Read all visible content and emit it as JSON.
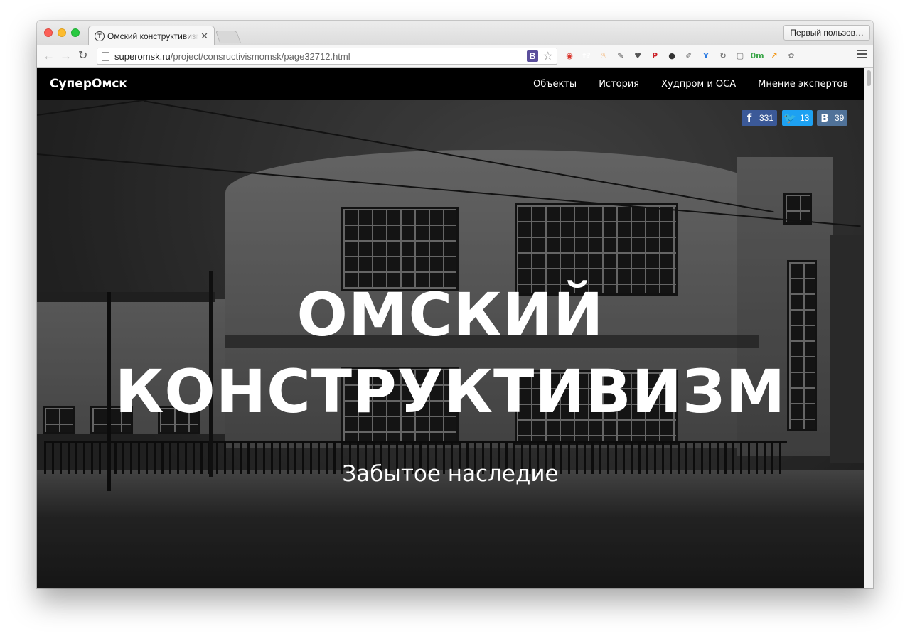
{
  "browser": {
    "tab_title": "Омский конструктивизм.",
    "tab_favicon": "T",
    "profile_button": "Первый пользов…",
    "url_host": "superomsk.ru",
    "url_path": "/project/consructivismomsk/page32712.html",
    "omnibox_badge": "B",
    "extensions": [
      {
        "name": "adblock-icon",
        "glyph": "◉",
        "color": "#d9342b"
      },
      {
        "name": "font-icon",
        "glyph": "f?",
        "color": "#ffffff"
      },
      {
        "name": "fire-icon",
        "glyph": "♨",
        "color": "#f28b22"
      },
      {
        "name": "evernote-icon",
        "glyph": "✎",
        "color": "#555555"
      },
      {
        "name": "pocket-icon",
        "glyph": "♥",
        "color": "#555555"
      },
      {
        "name": "pinterest-icon",
        "glyph": "P",
        "color": "#cb2027"
      },
      {
        "name": "camera-icon",
        "glyph": "●",
        "color": "#333333"
      },
      {
        "name": "eyedropper-icon",
        "glyph": "✐",
        "color": "#666666"
      },
      {
        "name": "yandex-icon",
        "glyph": "Y",
        "color": "#2a7ae2"
      },
      {
        "name": "sync-icon",
        "glyph": "↻",
        "color": "#777777"
      },
      {
        "name": "reader-icon",
        "glyph": "▢",
        "color": "#777777"
      },
      {
        "name": "badge-icon",
        "glyph": "0m",
        "color": "#3aa648"
      },
      {
        "name": "chart-icon",
        "glyph": "↗",
        "color": "#f39a1d"
      },
      {
        "name": "paw-icon",
        "glyph": "✿",
        "color": "#888888"
      }
    ]
  },
  "site": {
    "brand": "СуперОмск",
    "nav": [
      "Объекты",
      "История",
      "Худпром и ОСА",
      "Мнение экспертов"
    ]
  },
  "share": {
    "facebook_count": "331",
    "twitter_count": "13",
    "vk_count": "39"
  },
  "hero": {
    "title_line1": "ОМСКИЙ",
    "title_line2": "КОНСТРУКТИВИЗМ",
    "subtitle": "Забытое наследие"
  }
}
